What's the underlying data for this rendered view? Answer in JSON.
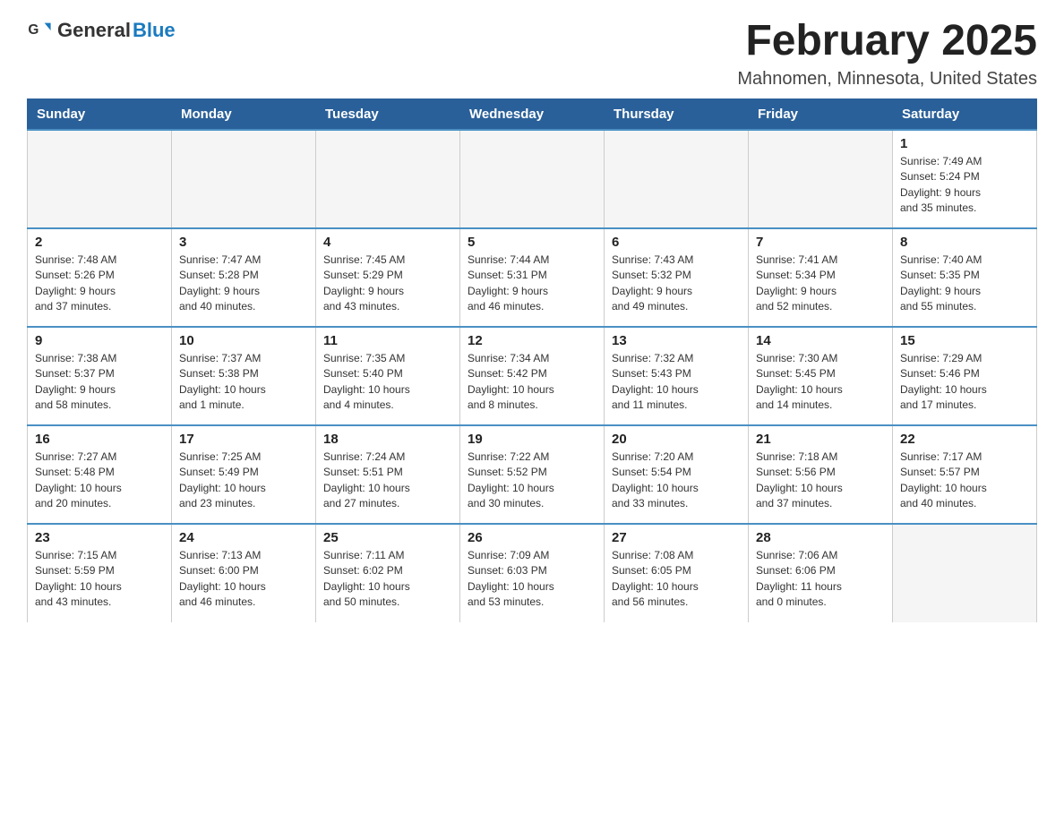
{
  "header": {
    "logo_general": "General",
    "logo_blue": "Blue",
    "title": "February 2025",
    "subtitle": "Mahnomen, Minnesota, United States"
  },
  "weekdays": [
    "Sunday",
    "Monday",
    "Tuesday",
    "Wednesday",
    "Thursday",
    "Friday",
    "Saturday"
  ],
  "weeks": [
    [
      {
        "day": "",
        "info": ""
      },
      {
        "day": "",
        "info": ""
      },
      {
        "day": "",
        "info": ""
      },
      {
        "day": "",
        "info": ""
      },
      {
        "day": "",
        "info": ""
      },
      {
        "day": "",
        "info": ""
      },
      {
        "day": "1",
        "info": "Sunrise: 7:49 AM\nSunset: 5:24 PM\nDaylight: 9 hours\nand 35 minutes."
      }
    ],
    [
      {
        "day": "2",
        "info": "Sunrise: 7:48 AM\nSunset: 5:26 PM\nDaylight: 9 hours\nand 37 minutes."
      },
      {
        "day": "3",
        "info": "Sunrise: 7:47 AM\nSunset: 5:28 PM\nDaylight: 9 hours\nand 40 minutes."
      },
      {
        "day": "4",
        "info": "Sunrise: 7:45 AM\nSunset: 5:29 PM\nDaylight: 9 hours\nand 43 minutes."
      },
      {
        "day": "5",
        "info": "Sunrise: 7:44 AM\nSunset: 5:31 PM\nDaylight: 9 hours\nand 46 minutes."
      },
      {
        "day": "6",
        "info": "Sunrise: 7:43 AM\nSunset: 5:32 PM\nDaylight: 9 hours\nand 49 minutes."
      },
      {
        "day": "7",
        "info": "Sunrise: 7:41 AM\nSunset: 5:34 PM\nDaylight: 9 hours\nand 52 minutes."
      },
      {
        "day": "8",
        "info": "Sunrise: 7:40 AM\nSunset: 5:35 PM\nDaylight: 9 hours\nand 55 minutes."
      }
    ],
    [
      {
        "day": "9",
        "info": "Sunrise: 7:38 AM\nSunset: 5:37 PM\nDaylight: 9 hours\nand 58 minutes."
      },
      {
        "day": "10",
        "info": "Sunrise: 7:37 AM\nSunset: 5:38 PM\nDaylight: 10 hours\nand 1 minute."
      },
      {
        "day": "11",
        "info": "Sunrise: 7:35 AM\nSunset: 5:40 PM\nDaylight: 10 hours\nand 4 minutes."
      },
      {
        "day": "12",
        "info": "Sunrise: 7:34 AM\nSunset: 5:42 PM\nDaylight: 10 hours\nand 8 minutes."
      },
      {
        "day": "13",
        "info": "Sunrise: 7:32 AM\nSunset: 5:43 PM\nDaylight: 10 hours\nand 11 minutes."
      },
      {
        "day": "14",
        "info": "Sunrise: 7:30 AM\nSunset: 5:45 PM\nDaylight: 10 hours\nand 14 minutes."
      },
      {
        "day": "15",
        "info": "Sunrise: 7:29 AM\nSunset: 5:46 PM\nDaylight: 10 hours\nand 17 minutes."
      }
    ],
    [
      {
        "day": "16",
        "info": "Sunrise: 7:27 AM\nSunset: 5:48 PM\nDaylight: 10 hours\nand 20 minutes."
      },
      {
        "day": "17",
        "info": "Sunrise: 7:25 AM\nSunset: 5:49 PM\nDaylight: 10 hours\nand 23 minutes."
      },
      {
        "day": "18",
        "info": "Sunrise: 7:24 AM\nSunset: 5:51 PM\nDaylight: 10 hours\nand 27 minutes."
      },
      {
        "day": "19",
        "info": "Sunrise: 7:22 AM\nSunset: 5:52 PM\nDaylight: 10 hours\nand 30 minutes."
      },
      {
        "day": "20",
        "info": "Sunrise: 7:20 AM\nSunset: 5:54 PM\nDaylight: 10 hours\nand 33 minutes."
      },
      {
        "day": "21",
        "info": "Sunrise: 7:18 AM\nSunset: 5:56 PM\nDaylight: 10 hours\nand 37 minutes."
      },
      {
        "day": "22",
        "info": "Sunrise: 7:17 AM\nSunset: 5:57 PM\nDaylight: 10 hours\nand 40 minutes."
      }
    ],
    [
      {
        "day": "23",
        "info": "Sunrise: 7:15 AM\nSunset: 5:59 PM\nDaylight: 10 hours\nand 43 minutes."
      },
      {
        "day": "24",
        "info": "Sunrise: 7:13 AM\nSunset: 6:00 PM\nDaylight: 10 hours\nand 46 minutes."
      },
      {
        "day": "25",
        "info": "Sunrise: 7:11 AM\nSunset: 6:02 PM\nDaylight: 10 hours\nand 50 minutes."
      },
      {
        "day": "26",
        "info": "Sunrise: 7:09 AM\nSunset: 6:03 PM\nDaylight: 10 hours\nand 53 minutes."
      },
      {
        "day": "27",
        "info": "Sunrise: 7:08 AM\nSunset: 6:05 PM\nDaylight: 10 hours\nand 56 minutes."
      },
      {
        "day": "28",
        "info": "Sunrise: 7:06 AM\nSunset: 6:06 PM\nDaylight: 11 hours\nand 0 minutes."
      },
      {
        "day": "",
        "info": ""
      }
    ]
  ]
}
